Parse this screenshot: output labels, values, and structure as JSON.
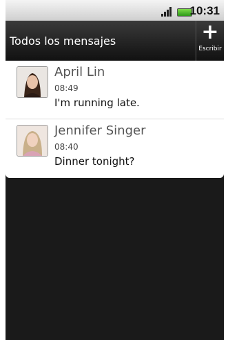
{
  "status_bar": {
    "time": "10:31"
  },
  "header": {
    "title": "Todos los mensajes",
    "compose_label": "Escribir",
    "compose_glyph": "+"
  },
  "threads": [
    {
      "name": "April Lin",
      "time": "08:49",
      "message": "I'm running late."
    },
    {
      "name": "Jennifer Singer",
      "time": "08:40",
      "message": "Dinner tonight?"
    }
  ],
  "colors": {
    "header_bg": "#1f1f1f",
    "list_bg": "#ffffff",
    "battery": "#4bc12a"
  }
}
